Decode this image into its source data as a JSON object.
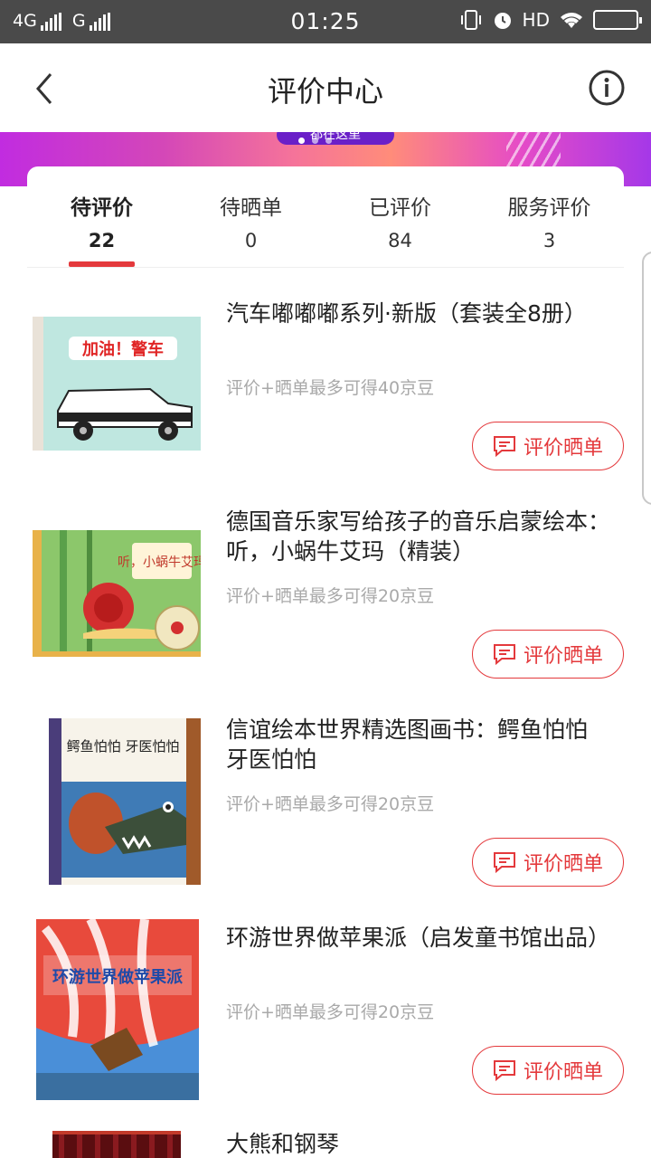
{
  "status_bar": {
    "network_1": "4G",
    "network_2": "G",
    "time": "01:25",
    "hd": "HD"
  },
  "header": {
    "title": "评价中心"
  },
  "banner": {
    "text": "都在这里"
  },
  "tabs": [
    {
      "label": "待评价",
      "count": "22",
      "active": true
    },
    {
      "label": "待晒单",
      "count": "0",
      "active": false
    },
    {
      "label": "已评价",
      "count": "84",
      "active": false
    },
    {
      "label": "服务评价",
      "count": "3",
      "active": false
    }
  ],
  "items": [
    {
      "title": "汽车嘟嘟嘟系列·新版（套装全8册）",
      "reward": "评价+晒单最多可得40京豆",
      "button": "评价晒单",
      "cover_text": "加油！警车",
      "cover_icon": "police-car-book-cover"
    },
    {
      "title": "德国音乐家写给孩子的音乐启蒙绘本：听，小蜗牛艾玛（精装）",
      "reward": "评价+晒单最多可得20京豆",
      "button": "评价晒单",
      "cover_text": "听，小蜗牛艾玛",
      "cover_icon": "snail-book-cover"
    },
    {
      "title": "信谊绘本世界精选图画书：鳄鱼怕怕 牙医怕怕",
      "reward": "评价+晒单最多可得20京豆",
      "button": "评价晒单",
      "cover_text": "鳄鱼怕怕 牙医怕怕",
      "cover_icon": "crocodile-book-cover"
    },
    {
      "title": "环游世界做苹果派（启发童书馆出品）",
      "reward": "评价+晒单最多可得20京豆",
      "button": "评价晒单",
      "cover_text": "环游世界做苹果派",
      "cover_icon": "balloon-book-cover"
    },
    {
      "title": "大熊和钢琴",
      "reward": "",
      "button": "",
      "cover_text": "",
      "cover_icon": "bear-piano-book-cover"
    }
  ],
  "colors": {
    "accent": "#e4393c",
    "status_bar": "#4a4a4a",
    "muted_text": "#a9a9a9"
  }
}
